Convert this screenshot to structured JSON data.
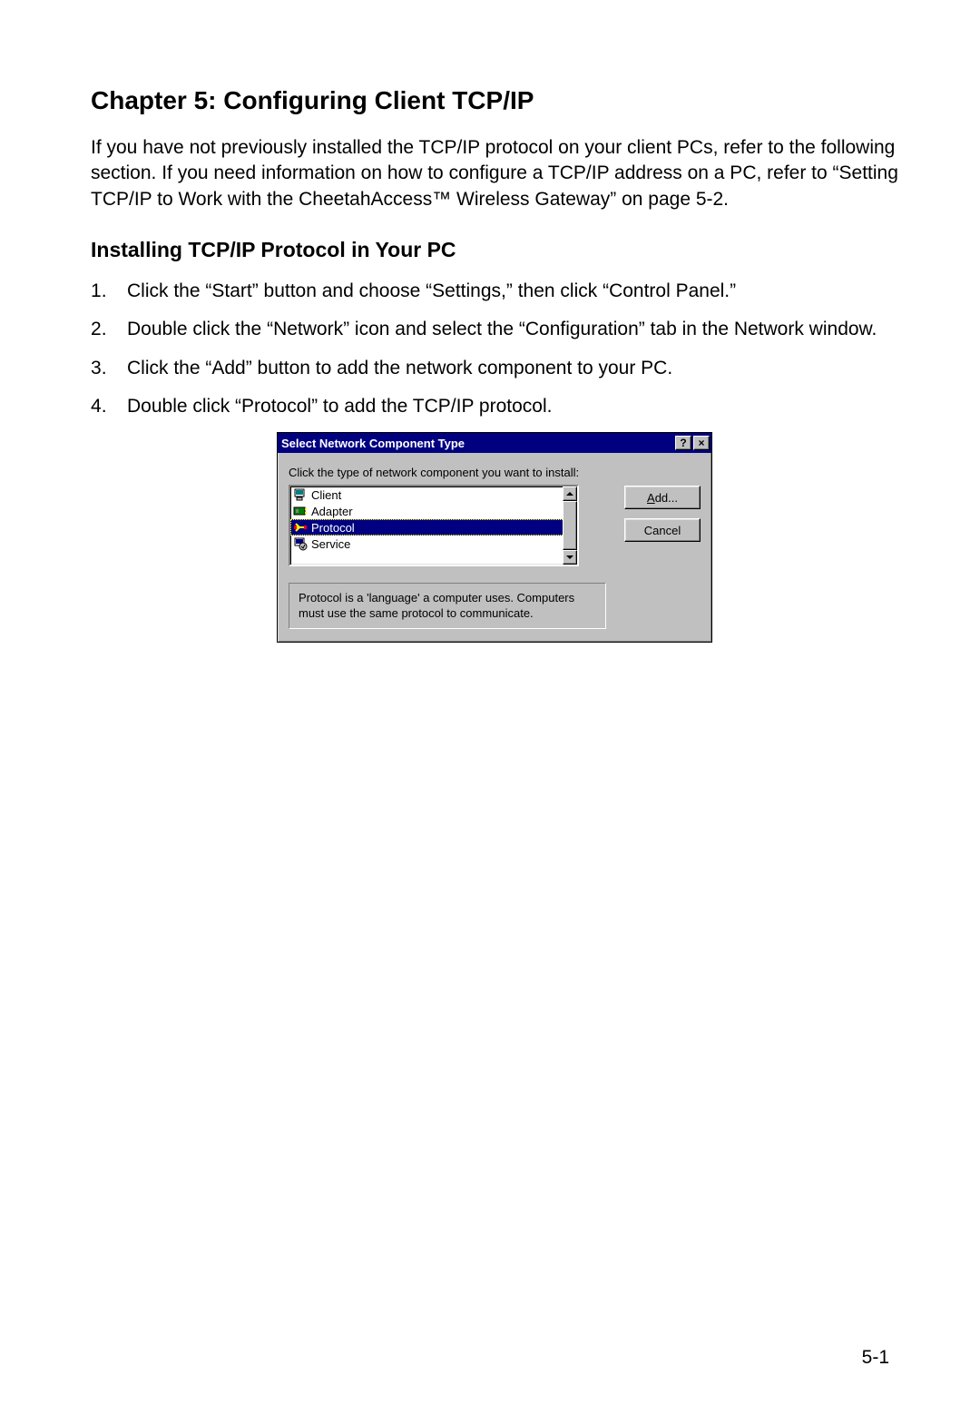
{
  "chapter_title": "Chapter 5: Configuring Client TCP/IP",
  "intro_text": "If you have not previously installed the TCP/IP protocol on your client PCs, refer to the following section. If you need information on how to configure a TCP/IP address on a PC, refer to “Setting TCP/IP to Work with the CheetahAccess™ Wireless Gateway” on page 5-2.",
  "section_title": "Installing TCP/IP Protocol in Your PC",
  "steps": [
    "Click the “Start” button and choose “Settings,” then click “Control Panel.”",
    "Double click the “Network” icon and select the “Configuration” tab in the Network window.",
    "Click the “Add” button to add the network component to your PC.",
    "Double click “Protocol” to add the TCP/IP protocol."
  ],
  "dialog": {
    "title": "Select Network Component Type",
    "help_btn": "?",
    "close_btn": "×",
    "instruction": "Click the type of network component you want to install:",
    "items": [
      {
        "label": "Client",
        "icon": "client-icon",
        "selected": false
      },
      {
        "label": "Adapter",
        "icon": "adapter-icon",
        "selected": false
      },
      {
        "label": "Protocol",
        "icon": "protocol-icon",
        "selected": true
      },
      {
        "label": "Service",
        "icon": "service-icon",
        "selected": false
      }
    ],
    "add_btn_prefix": "A",
    "add_btn_rest": "dd...",
    "cancel_btn": "Cancel",
    "description": "Protocol is a 'language' a computer uses. Computers must use the same protocol to communicate."
  },
  "page_number": "5-1"
}
